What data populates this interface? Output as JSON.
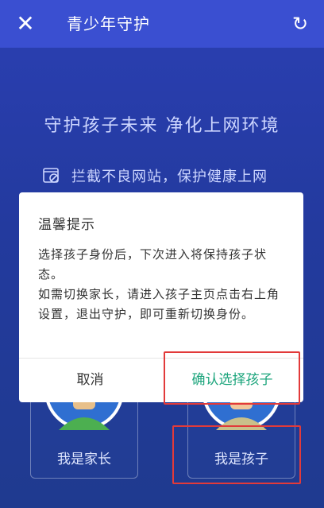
{
  "topbar": {
    "title": "青少年守护",
    "close_icon": "close-icon",
    "refresh_icon": "refresh-icon"
  },
  "hero": {
    "slogan": "守护孩子未来 净化上网环境",
    "feature_text": "拦截不良网站，保护健康上网",
    "feature_icon": "blocked-site-icon"
  },
  "roles": [
    {
      "label": "我是家长"
    },
    {
      "label": "我是孩子"
    }
  ],
  "dialog": {
    "title": "温馨提示",
    "message_lines": [
      "选择孩子身份后，下次进入将保持孩子状态。",
      "如需切换家长，请进入孩子主页点击右上角设置，退出守护，即可重新切换身份。"
    ],
    "cancel_label": "取消",
    "confirm_label": "确认选择孩子"
  },
  "colors": {
    "topbar": "#3a4fd1",
    "background": "#233a9e",
    "confirm_text": "#1aa47b",
    "highlight": "#e23a3a"
  }
}
